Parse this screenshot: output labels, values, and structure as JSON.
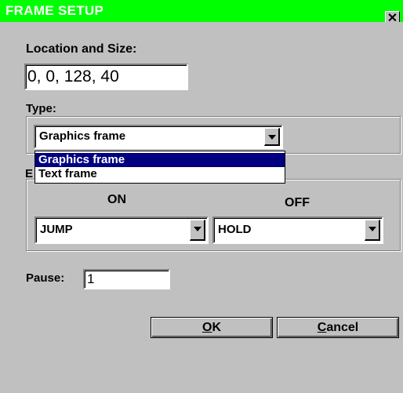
{
  "window": {
    "title": "FRAME SETUP",
    "close_glyph": "✕"
  },
  "location": {
    "label": "Location and Size:",
    "value": "0, 0, 128, 40"
  },
  "type": {
    "label": "Type:",
    "selected": "Graphics frame",
    "options": [
      "Graphics frame",
      "Text frame"
    ]
  },
  "effects": {
    "label_fragment": "E",
    "on_label": "ON",
    "off_label": "OFF",
    "on_value": "JUMP",
    "off_value": "HOLD"
  },
  "pause": {
    "label": "Pause:",
    "value": "1"
  },
  "buttons": {
    "ok_mnemonic": "O",
    "ok_rest": "K",
    "cancel_mnemonic": "C",
    "cancel_rest": "ancel"
  },
  "colors": {
    "title_bar": "#00ff00",
    "dialog_bg": "#c0c0c0",
    "selection": "#000080"
  }
}
